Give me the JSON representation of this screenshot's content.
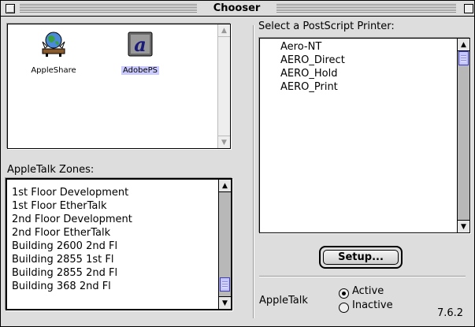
{
  "window": {
    "title": "Chooser"
  },
  "devices": [
    {
      "label": "AppleShare",
      "icon": "appleshare-icon",
      "selected": false
    },
    {
      "label": "AdobePS",
      "icon": "adobeps-icon",
      "selected": true
    }
  ],
  "zones": {
    "heading": "AppleTalk Zones:",
    "items": [
      "1st Floor Development",
      "1st Floor EtherTalk",
      "2nd Floor Development",
      "2nd Floor EtherTalk",
      "Building 2600 2nd Fl",
      "Building 2855 1st Fl",
      "Building 2855 2nd Fl",
      "Building 368 2nd Fl"
    ]
  },
  "printers": {
    "heading": "Select a PostScript Printer:",
    "items": [
      "Aero-NT",
      "AERO_Direct",
      "AERO_Hold",
      "AERO_Print"
    ]
  },
  "setup": {
    "label": "Setup..."
  },
  "appletalk": {
    "label": "AppleTalk",
    "active_label": "Active",
    "inactive_label": "Inactive",
    "selected": "Active"
  },
  "version": "7.6.2",
  "colors": {
    "selection": "#cbcbff",
    "thumb": "#c6c6ff",
    "window_bg": "#dddddd"
  }
}
